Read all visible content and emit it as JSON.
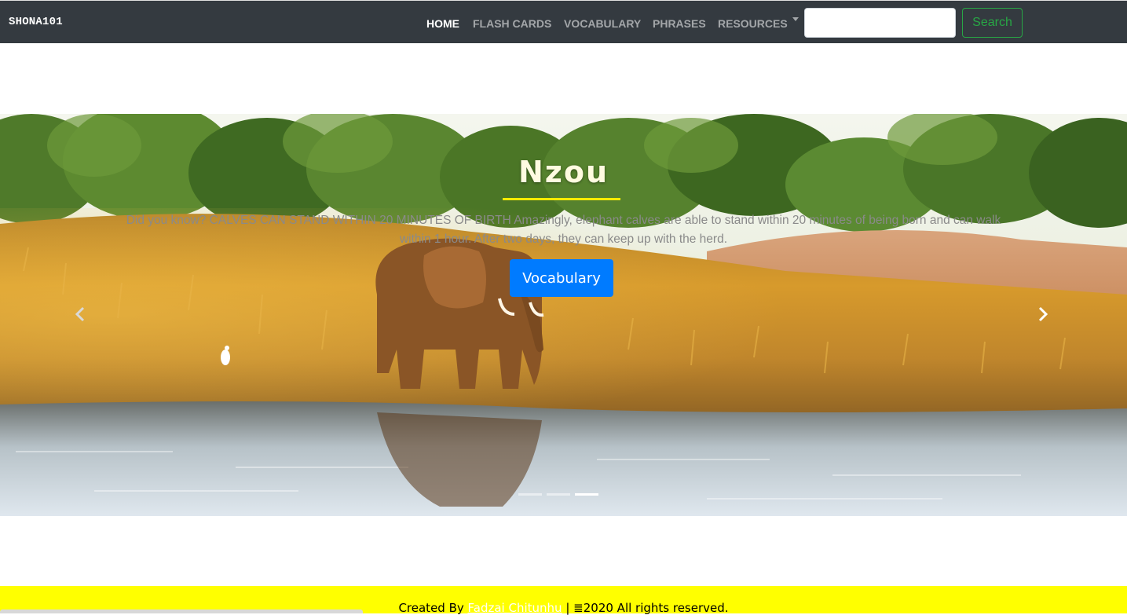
{
  "navbar": {
    "brand": "SHONA101",
    "links": [
      {
        "label": "HOME",
        "active": true
      },
      {
        "label": "FLASH CARDS",
        "active": false
      },
      {
        "label": "VOCABULARY",
        "active": false
      },
      {
        "label": "PHRASES",
        "active": false
      },
      {
        "label": "RESOURCES",
        "active": false
      }
    ],
    "search": {
      "value": "",
      "placeholder": "",
      "button_label": "Search"
    }
  },
  "carousel": {
    "title": "Nzou",
    "text": "Did you know? CALVES CAN STAND WITHIN 20 MINUTES OF BIRTH Amazingly, elephant calves are able to stand within 20 minutes of being born and can walk within 1 hour. After two days, they can keep up with the herd.",
    "button_label": "Vocabulary",
    "prev_icon": "chevron-left-icon",
    "next_icon": "chevron-right-icon",
    "slide_count": 3,
    "active_slide": 2
  },
  "footer": {
    "prefix": "Created By ",
    "author": "Fadzai Chitunhu",
    "separator": " | ",
    "icon": "menu-icon",
    "icon_glyph": "≣",
    "suffix": "2020 All rights reserved."
  },
  "colors": {
    "navbar_bg": "#343a40",
    "primary": "#007bff",
    "success": "#28a745",
    "footer_bg": "#ffff00",
    "title_underline": "#ffeb00"
  }
}
